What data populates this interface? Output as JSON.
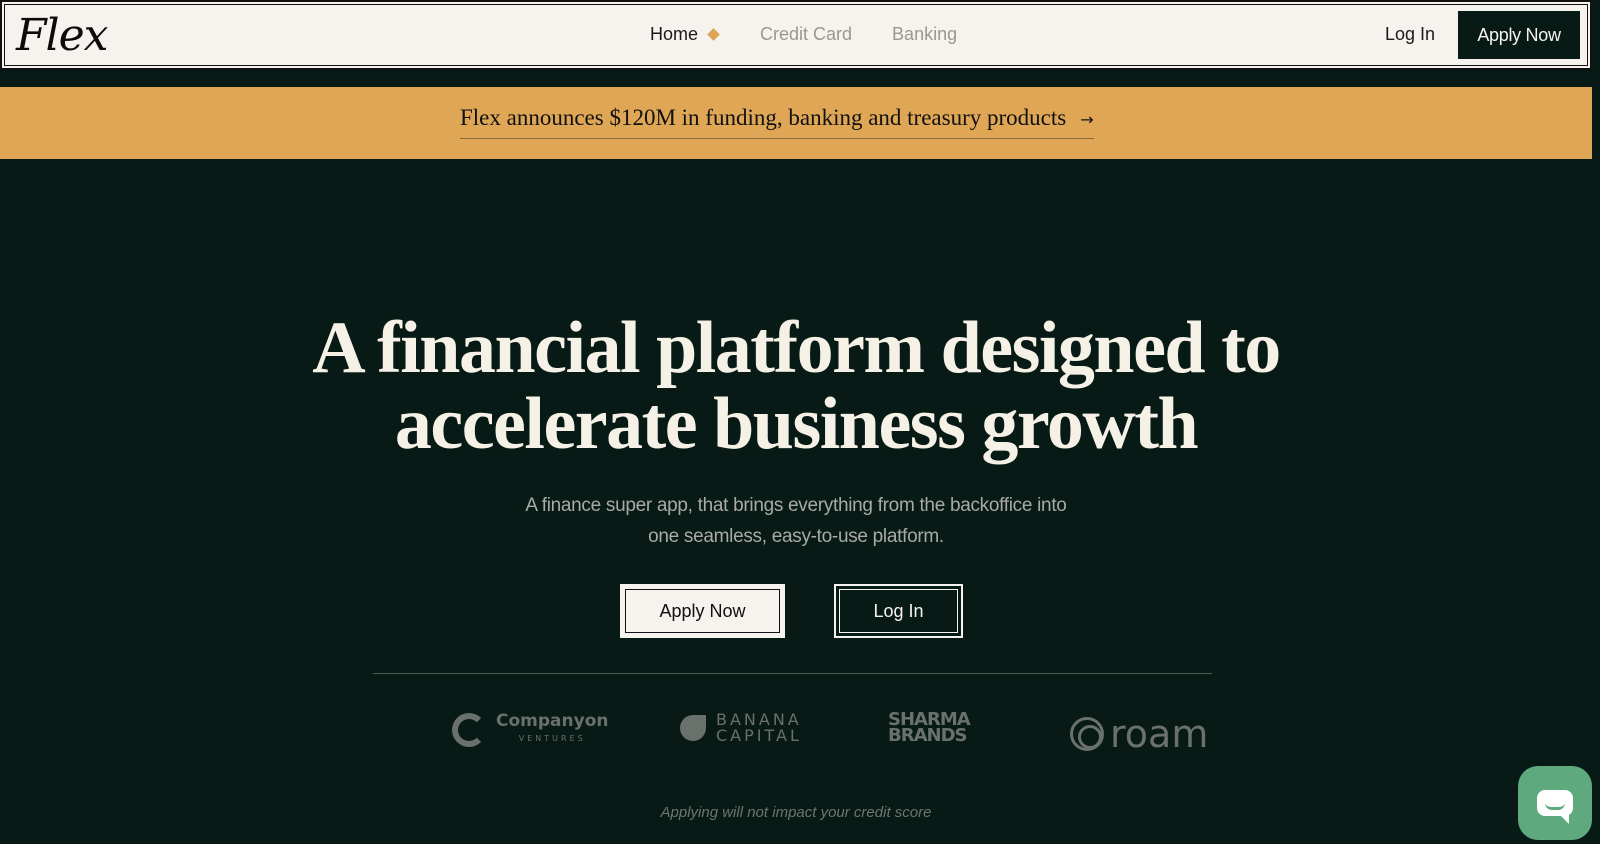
{
  "header": {
    "logo": "Flex",
    "nav": [
      {
        "label": "Home",
        "active": true
      },
      {
        "label": "Credit Card",
        "active": false
      },
      {
        "label": "Banking",
        "active": false
      }
    ],
    "login_label": "Log In",
    "apply_label": "Apply Now"
  },
  "announcement": {
    "text": "Flex announces $120M in funding, banking and treasury products",
    "arrow_icon": "arrow-right-icon"
  },
  "hero": {
    "title_line1": "A financial platform designed to",
    "title_line2": "accelerate business growth",
    "subtitle_line1": "A finance super app, that brings everything from the backoffice into",
    "subtitle_line2": "one seamless, easy-to-use platform.",
    "apply_label": "Apply Now",
    "login_label": "Log In"
  },
  "partners": [
    {
      "name": "Companyon",
      "sub": "VENTURES"
    },
    {
      "name": "BANANA",
      "sub": "CAPITAL"
    },
    {
      "name": "SHARMA",
      "sub": "BRANDS"
    },
    {
      "name": "roam",
      "sub": ""
    }
  ],
  "disclaimer": "Applying will not impact your credit score",
  "colors": {
    "background": "#071a15",
    "cream": "#f6f3ee",
    "accent": "#dfa755",
    "chat": "#5fa97e"
  },
  "chat_widget": {
    "icon": "chat-icon"
  }
}
